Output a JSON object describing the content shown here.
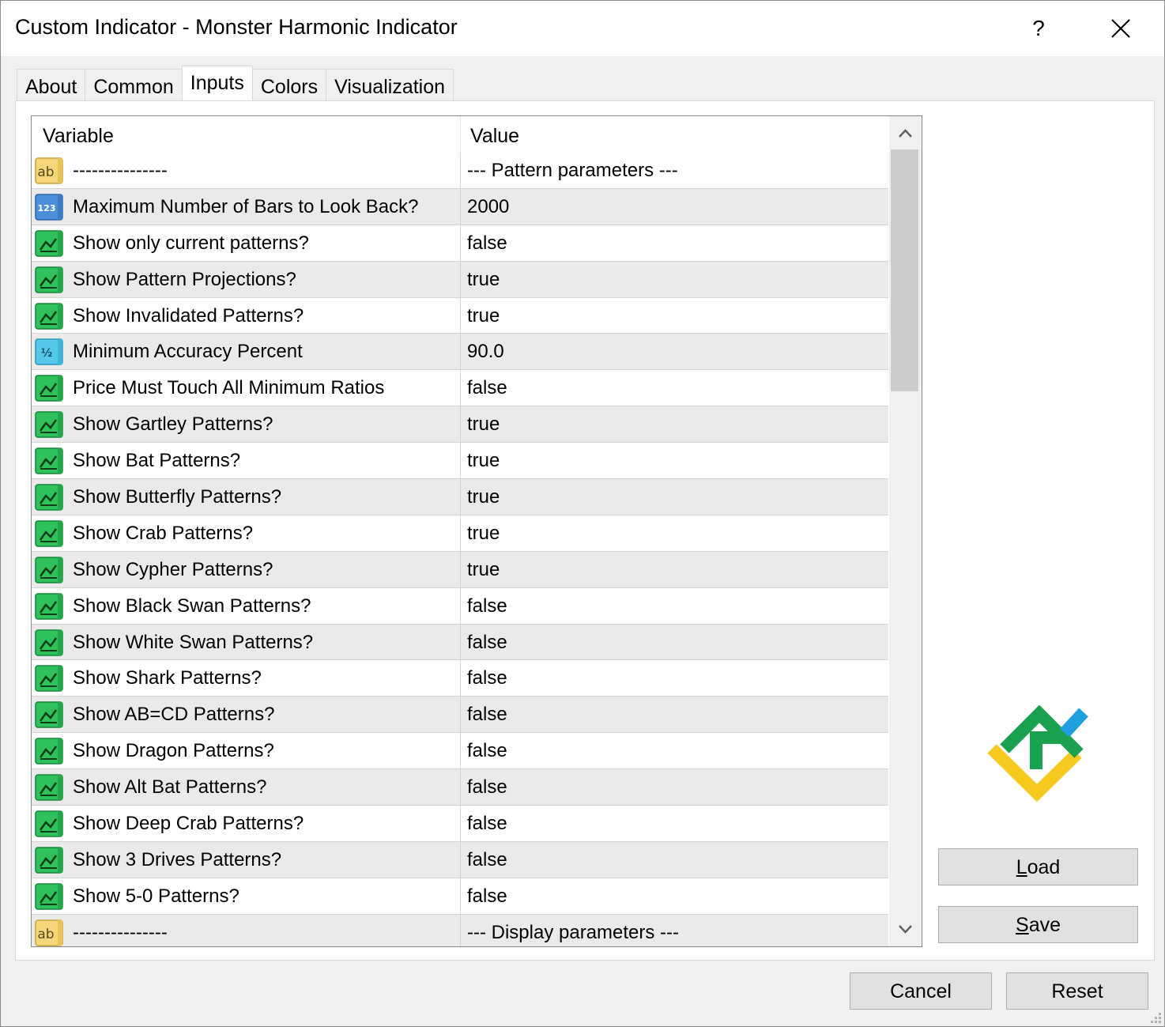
{
  "window": {
    "title": "Custom Indicator - Monster Harmonic Indicator",
    "help_label": "?"
  },
  "tabs": [
    {
      "label": "About"
    },
    {
      "label": "Common"
    },
    {
      "label": "Inputs"
    },
    {
      "label": "Colors"
    },
    {
      "label": "Visualization"
    }
  ],
  "active_tab": "Inputs",
  "grid": {
    "headers": {
      "variable": "Variable",
      "value": "Value"
    },
    "rows": [
      {
        "icon": "string-ab-icon",
        "variable": "---------------",
        "value": "--- Pattern parameters ---"
      },
      {
        "icon": "integer-123-icon",
        "variable": "Maximum Number of Bars to Look Back?",
        "value": "2000"
      },
      {
        "icon": "boolean-icon",
        "variable": "Show only current patterns?",
        "value": "false"
      },
      {
        "icon": "boolean-icon",
        "variable": "Show Pattern Projections?",
        "value": "true"
      },
      {
        "icon": "boolean-icon",
        "variable": "Show Invalidated Patterns?",
        "value": "true"
      },
      {
        "icon": "double-v2-icon",
        "variable": "Minimum Accuracy Percent",
        "value": "90.0"
      },
      {
        "icon": "boolean-icon",
        "variable": "Price Must Touch All Minimum Ratios",
        "value": "false"
      },
      {
        "icon": "boolean-icon",
        "variable": "Show Gartley Patterns?",
        "value": "true"
      },
      {
        "icon": "boolean-icon",
        "variable": "Show Bat Patterns?",
        "value": "true"
      },
      {
        "icon": "boolean-icon",
        "variable": "Show Butterfly Patterns?",
        "value": "true"
      },
      {
        "icon": "boolean-icon",
        "variable": "Show Crab Patterns?",
        "value": "true"
      },
      {
        "icon": "boolean-icon",
        "variable": "Show Cypher Patterns?",
        "value": "true"
      },
      {
        "icon": "boolean-icon",
        "variable": "Show Black Swan Patterns?",
        "value": "false"
      },
      {
        "icon": "boolean-icon",
        "variable": "Show White Swan Patterns?",
        "value": "false"
      },
      {
        "icon": "boolean-icon",
        "variable": "Show Shark Patterns?",
        "value": "false"
      },
      {
        "icon": "boolean-icon",
        "variable": "Show AB=CD Patterns?",
        "value": "false"
      },
      {
        "icon": "boolean-icon",
        "variable": "Show Dragon Patterns?",
        "value": "false"
      },
      {
        "icon": "boolean-icon",
        "variable": "Show Alt Bat Patterns?",
        "value": "false"
      },
      {
        "icon": "boolean-icon",
        "variable": "Show Deep Crab Patterns?",
        "value": "false"
      },
      {
        "icon": "boolean-icon",
        "variable": "Show 3 Drives Patterns?",
        "value": "false"
      },
      {
        "icon": "boolean-icon",
        "variable": "Show 5-0 Patterns?",
        "value": "false"
      },
      {
        "icon": "string-ab-icon",
        "variable": "---------------",
        "value": "--- Display parameters ---"
      }
    ]
  },
  "buttons": {
    "load": {
      "pre": "",
      "key": "L",
      "post": "oad"
    },
    "save": {
      "pre": "",
      "key": "S",
      "post": "ave"
    },
    "cancel": "Cancel",
    "reset": "Reset"
  },
  "colors": {
    "accent_green": "#1fa84a",
    "logo_green": "#1aa150",
    "logo_yellow": "#f7c81e",
    "logo_blue": "#1e9fe0"
  }
}
